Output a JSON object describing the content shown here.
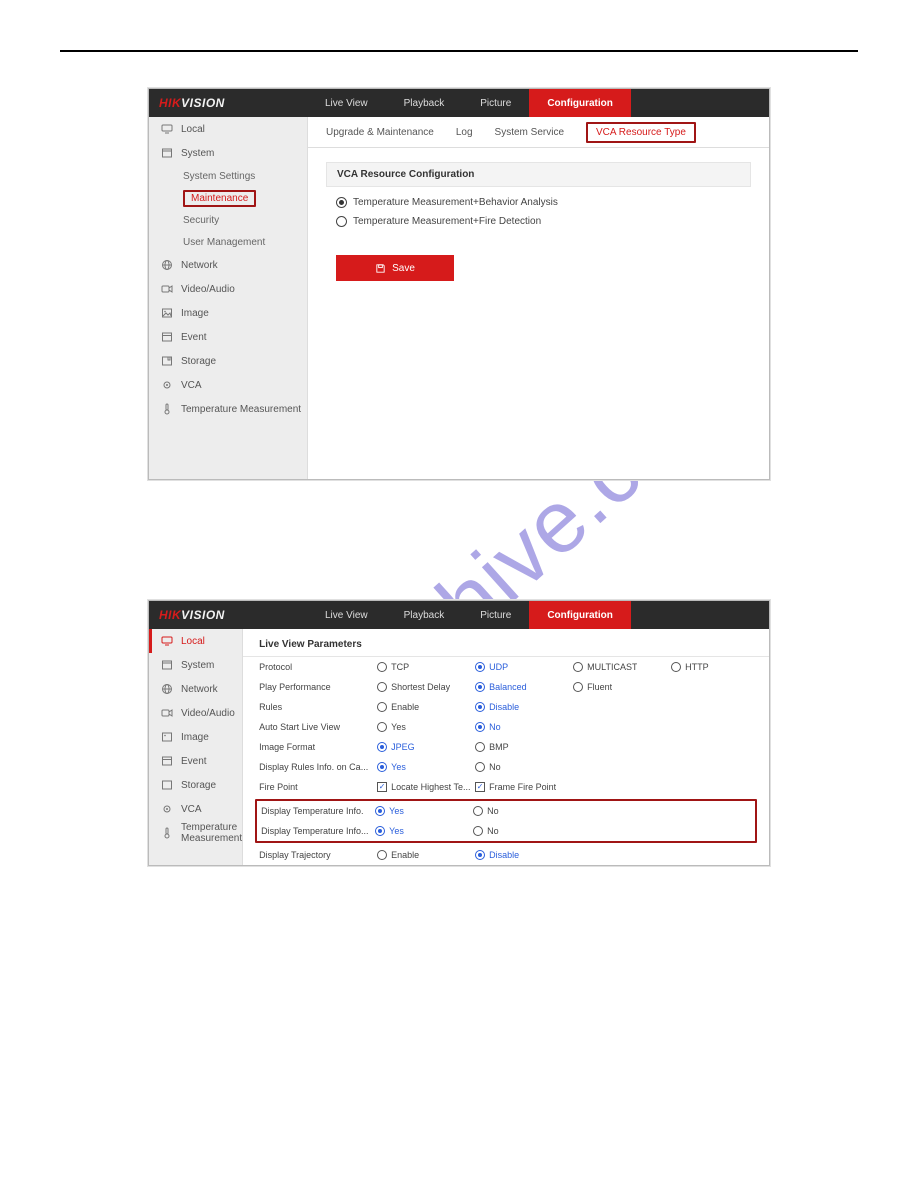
{
  "watermark": "manualshive.com",
  "brand": {
    "hik": "HIK",
    "vision": "VISION"
  },
  "nav": {
    "live_view": "Live View",
    "playback": "Playback",
    "picture": "Picture",
    "configuration": "Configuration"
  },
  "shot1": {
    "sidebar": {
      "local": "Local",
      "system": "System",
      "system_settings": "System Settings",
      "maintenance": "Maintenance",
      "security": "Security",
      "user_management": "User Management",
      "network": "Network",
      "video_audio": "Video/Audio",
      "image": "Image",
      "event": "Event",
      "storage": "Storage",
      "vca": "VCA",
      "temperature": "Temperature Measurement"
    },
    "tabs": {
      "upgrade": "Upgrade & Maintenance",
      "log": "Log",
      "system_service": "System Service",
      "vca_resource_type": "VCA Resource Type"
    },
    "section_title": "VCA Resource Configuration",
    "option_behavior": "Temperature Measurement+Behavior Analysis",
    "option_fire": "Temperature Measurement+Fire Detection",
    "save": "Save"
  },
  "shot2": {
    "sidebar": {
      "local": "Local",
      "system": "System",
      "network": "Network",
      "video_audio": "Video/Audio",
      "image": "Image",
      "event": "Event",
      "storage": "Storage",
      "vca": "VCA",
      "temperature": "Temperature Measurement"
    },
    "panel_title": "Live View Parameters",
    "rows": {
      "protocol": {
        "label": "Protocol",
        "tcp": "TCP",
        "udp": "UDP",
        "multicast": "MULTICAST",
        "http": "HTTP"
      },
      "play_performance": {
        "label": "Play Performance",
        "shortest": "Shortest Delay",
        "balanced": "Balanced",
        "fluent": "Fluent"
      },
      "rules": {
        "label": "Rules",
        "enable": "Enable",
        "disable": "Disable"
      },
      "auto_start": {
        "label": "Auto Start Live View",
        "yes": "Yes",
        "no": "No"
      },
      "image_format": {
        "label": "Image Format",
        "jpeg": "JPEG",
        "bmp": "BMP"
      },
      "display_rules_ca": {
        "label": "Display Rules Info. on Ca...",
        "yes": "Yes",
        "no": "No"
      },
      "fire_point": {
        "label": "Fire Point",
        "locate": "Locate Highest Te...",
        "frame": "Frame Fire Point"
      },
      "display_temp_a": {
        "label": "Display Temperature Info.",
        "yes": "Yes",
        "no": "No"
      },
      "display_temp_b": {
        "label": "Display Temperature Info...",
        "yes": "Yes",
        "no": "No"
      },
      "display_trajectory": {
        "label": "Display Trajectory",
        "enable": "Enable",
        "disable": "Disable"
      }
    }
  }
}
